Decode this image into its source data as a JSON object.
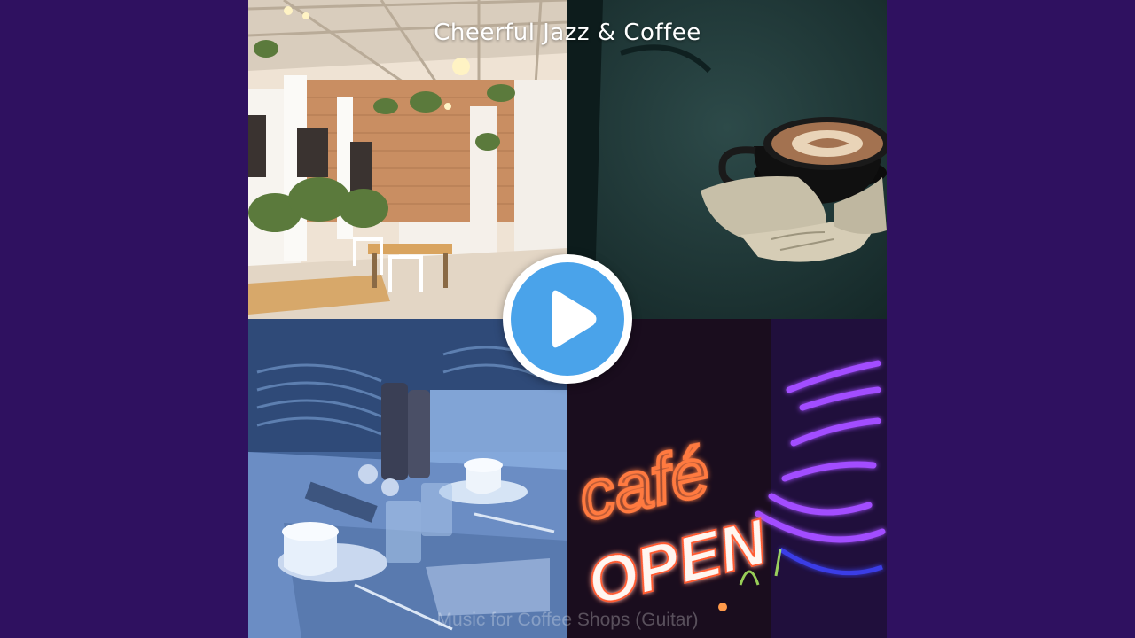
{
  "cover": {
    "title": "Cheerful Jazz & Coffee",
    "subtitle": "Music for Coffee Shops (Guitar)",
    "sign_text_top": "café",
    "sign_text_bottom": "OPEN"
  },
  "player": {
    "play_icon": "play-icon",
    "accent_color": "#4aa3ea",
    "background_color": "#2e0f5e"
  }
}
